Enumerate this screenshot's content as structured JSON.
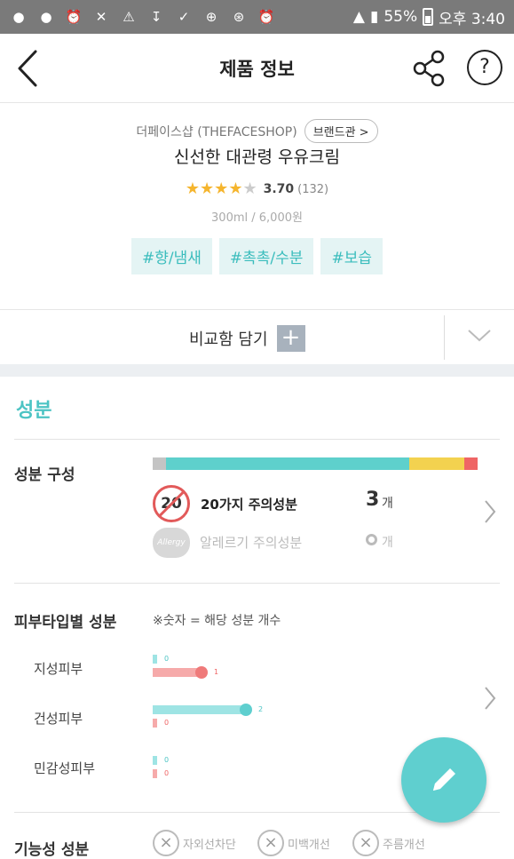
{
  "status_bar": {
    "battery": "55%",
    "time": "오후 3:40",
    "icons": [
      "message-icon",
      "talk-icon",
      "alarm-icon",
      "mute-icon",
      "warning-icon",
      "download-icon",
      "check-icon",
      "plus-circle-icon",
      "bluetooth-icon",
      "alarm-icon",
      "wifi-icon",
      "signal-icon",
      "battery-icon"
    ]
  },
  "header": {
    "title": "제품 정보"
  },
  "product": {
    "brand": "더페이스샵 (THEFACESHOP)",
    "brand_button": "브랜드관 >",
    "name": "신선한 대관령 우유크림",
    "rating": "3.70",
    "rating_count": "(132)",
    "stars_filled": 3.7,
    "volume_price": "300ml / 6,000원",
    "tags": [
      "#향/냄새",
      "#촉촉/수분",
      "#보습"
    ]
  },
  "compare": {
    "label": "비교함 담기"
  },
  "ingredients": {
    "section_title": "성분",
    "composition_label": "성분 구성",
    "composition_bar": [
      {
        "color": "#c4c4c4",
        "fraction": 0.04
      },
      {
        "color": "#5ed0cc",
        "fraction": 0.75
      },
      {
        "color": "#f3d24f",
        "fraction": 0.17
      },
      {
        "color": "#ef6565",
        "fraction": 0.04
      }
    ],
    "caution20_badge": "20",
    "caution20_label": "20가지 주의성분",
    "caution20_count": "3",
    "caution20_unit": "개",
    "allergy_badge": "Allergy",
    "allergy_label": "알레르기 주의성분",
    "allergy_count": "0",
    "allergy_unit": "개",
    "skin_label": "피부타입별 성분",
    "skin_note": "※숫자 = 해당 성분 개수",
    "skin_rows": [
      {
        "label": "지성피부",
        "good": "0",
        "bad": "1"
      },
      {
        "label": "건성피부",
        "good": "2",
        "bad": "0"
      },
      {
        "label": "민감성피부",
        "good": "0",
        "bad": "0"
      }
    ],
    "functional_label": "기능성 성분",
    "functional_items": [
      "자외선차단",
      "미백개선",
      "주름개선"
    ]
  },
  "colors": {
    "accent": "#4cc4c4",
    "tag_bg": "#e4f4f4",
    "good_bar": "#9ee4e4",
    "bad_bar": "#f6aaaa",
    "fab": "#5fcfcf"
  }
}
